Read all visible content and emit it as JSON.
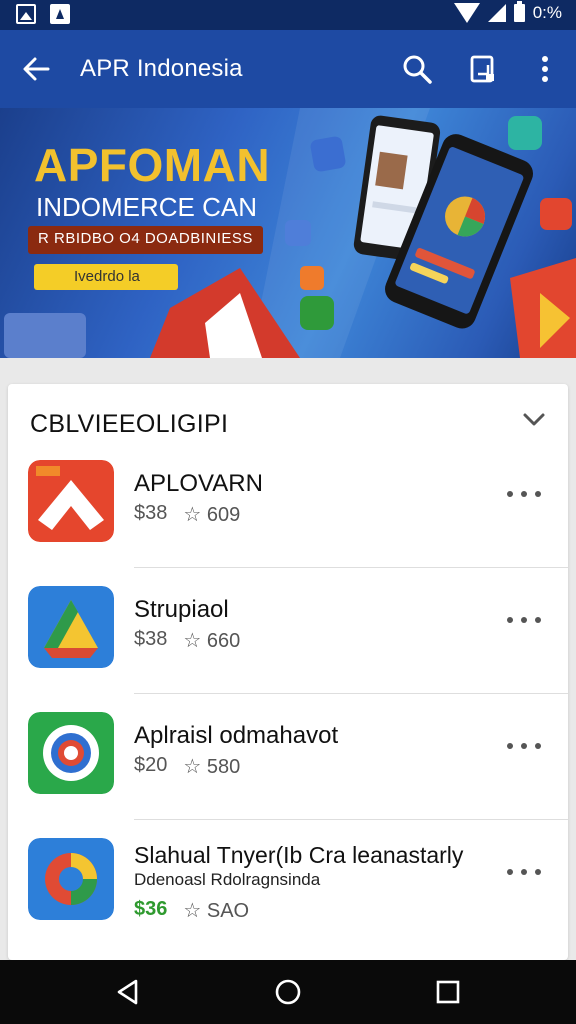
{
  "status_bar": {
    "time": "0:%",
    "icons": [
      "image-icon",
      "navigation-icon",
      "wifi-icon",
      "signal-icon",
      "battery-icon"
    ]
  },
  "app_bar": {
    "title": "APR Indonesia",
    "back_icon": "arrow-left-icon",
    "actions": [
      "search-icon",
      "cast-icon",
      "more-vert-icon"
    ]
  },
  "banner": {
    "title": "APFOMAN",
    "subtitle": "INDOMERCE CAN",
    "tag": "R RBIDBO O4 DOADBINIESS",
    "button_label": "Ivedrdo la"
  },
  "section": {
    "title": "CBLVIEEOLIGIPI",
    "collapse_icon": "chevron-down-icon"
  },
  "apps": [
    {
      "name": "APLOVARN",
      "subtitle": "",
      "price": "$38",
      "rating": "609",
      "icon": "orange-arrow-icon",
      "more_icon": "more-horiz-icon"
    },
    {
      "name": "Strupiaol",
      "subtitle": "",
      "price": "$38",
      "rating": "660",
      "icon": "triangle-drive-icon",
      "more_icon": "more-horiz-icon"
    },
    {
      "name": "Aplraisl odmahavot",
      "subtitle": "",
      "price": "$20",
      "rating": "580",
      "icon": "green-gear-icon",
      "more_icon": "more-horiz-icon"
    },
    {
      "name": "Slahual Tnyer(Ib Cra leanastarly",
      "subtitle": "Ddenoasl Rdolragnsinda",
      "price": "$36",
      "rating": "SAO",
      "price_color": "#2f9a2f",
      "icon": "colorful-circle-icon",
      "more_icon": "more-horiz-icon"
    }
  ],
  "colors": {
    "status_bar": "#0e2a63",
    "app_bar": "#1e4aa3",
    "banner_title": "#f2c12e",
    "accent_green": "#2f9a2f"
  },
  "nav_bar": {
    "buttons": [
      "back-triangle-icon",
      "home-circle-icon",
      "recents-square-icon"
    ]
  }
}
